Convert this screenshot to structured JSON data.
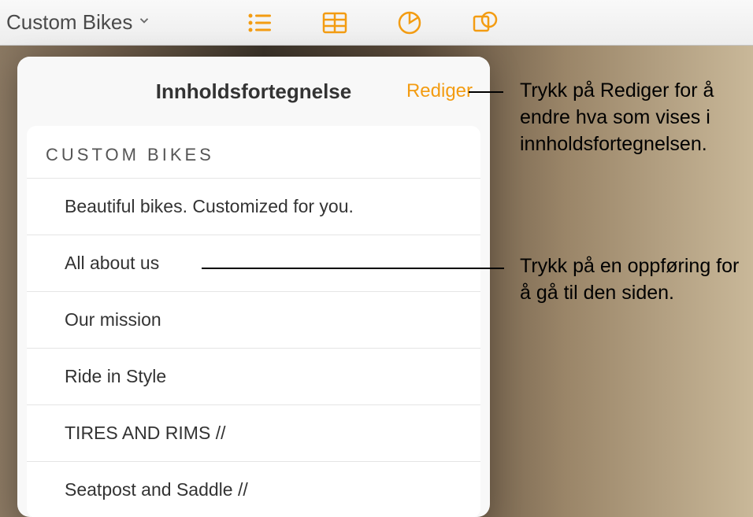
{
  "toolbar": {
    "doc_title": "Custom Bikes"
  },
  "popover": {
    "title": "Innholdsfortegnelse",
    "edit_label": "Rediger",
    "heading": "CUSTOM  BIKES",
    "items": [
      "Beautiful bikes. Customized for you.",
      "All about us",
      "Our mission",
      "Ride in Style",
      "TIRES AND RIMS //",
      "Seatpost and Saddle //"
    ]
  },
  "callouts": {
    "edit_callout": "Trykk på Rediger for å endre hva som vises i innholdsfortegnelsen.",
    "item_callout": "Trykk på en oppføring for å gå til den siden."
  },
  "colors": {
    "accent": "#f39c12"
  }
}
